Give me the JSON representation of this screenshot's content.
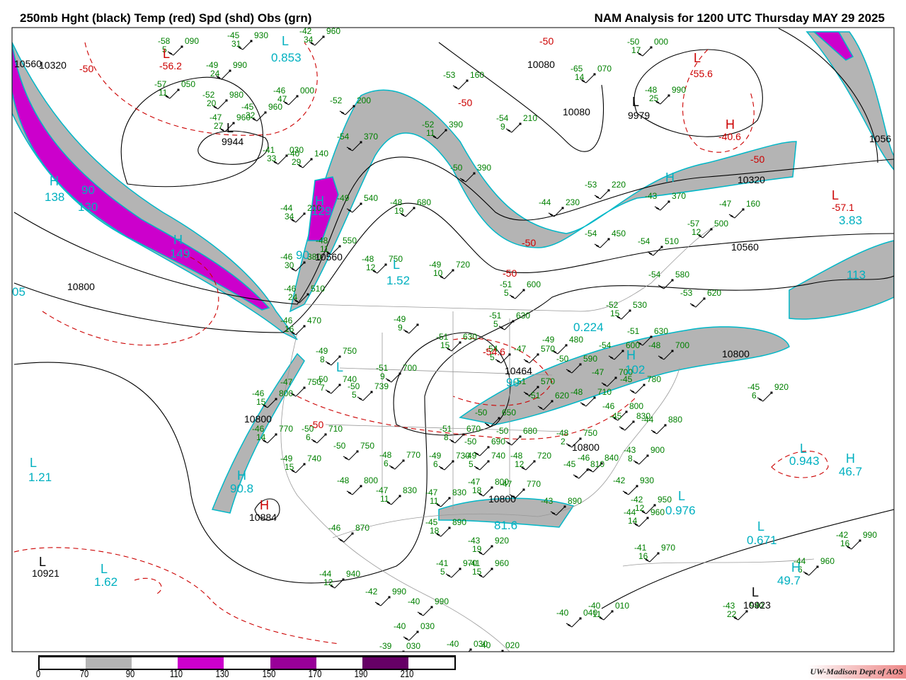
{
  "header": {
    "left_title": "250mb Hght (black) Temp (red) Spd (shd) Obs (grn)",
    "right_title": "NAM Analysis for 1200 UTC Thursday  MAY 29 2025"
  },
  "colors": {
    "height": "#000000",
    "temp": "#cc0000",
    "speed_label": "#00b0c0",
    "obs": "#008000",
    "shade_70_90": "#b4b4b4",
    "shade_110_130": "#cc00cc",
    "shade_150_170": "#990099",
    "shade_190_210": "#660066"
  },
  "legend": {
    "ticks": [
      "0",
      "70",
      "90",
      "110",
      "130",
      "150",
      "170",
      "190",
      "210"
    ],
    "segments": [
      "#ffffff",
      "#b4b4b4",
      "#ffffff",
      "#cc00cc",
      "#ffffff",
      "#990099",
      "#ffffff",
      "#660066",
      "#ffffff"
    ]
  },
  "credit": "UW-Madison   Dept of AOS",
  "height_labels": [
    "10560",
    "10320",
    "10080",
    "10080",
    "9979",
    "9944",
    "10320",
    "10560",
    "10560",
    "10800",
    "10800",
    "10464",
    "10800",
    "10800",
    "10800",
    "10884",
    "10921",
    "10923",
    "1056"
  ],
  "temp_labels": [
    "-56.2",
    "-50",
    "-50",
    "-55.6",
    "-40.6",
    "-50",
    "-57.1",
    "-50",
    "-50",
    "-50",
    "-54.6",
    "-50"
  ],
  "speed_labels": [
    "0.853",
    "138",
    "90",
    "130",
    "149",
    "129",
    "90",
    "05",
    "1.52",
    "0.224",
    "102",
    "3.83",
    "113",
    "1.21",
    "0.943",
    "46.7",
    "0.976",
    "0.671",
    "1.62",
    "49.7",
    "90.8",
    "81.6",
    "90"
  ],
  "centers": [
    {
      "type": "L",
      "color": "speed"
    },
    {
      "type": "H",
      "color": "speed"
    },
    {
      "type": "H",
      "color": "speed"
    },
    {
      "type": "H",
      "color": "speed"
    },
    {
      "type": "L",
      "color": "height"
    },
    {
      "type": "L",
      "color": "height"
    },
    {
      "type": "L",
      "color": "temp"
    },
    {
      "type": "L",
      "color": "temp"
    },
    {
      "type": "H",
      "color": "temp"
    },
    {
      "type": "L",
      "color": "temp"
    },
    {
      "type": "L",
      "color": "speed"
    },
    {
      "type": "H",
      "color": "speed"
    },
    {
      "type": "H",
      "color": "speed"
    },
    {
      "type": "L",
      "color": "speed"
    },
    {
      "type": "L",
      "color": "speed"
    },
    {
      "type": "H",
      "color": "speed"
    },
    {
      "type": "L",
      "color": "speed"
    },
    {
      "type": "L",
      "color": "speed"
    },
    {
      "type": "L",
      "color": "speed"
    },
    {
      "type": "H",
      "color": "speed"
    },
    {
      "type": "H",
      "color": "temp"
    },
    {
      "type": "L",
      "color": "height"
    },
    {
      "type": "L",
      "color": "height"
    },
    {
      "type": "H",
      "color": "speed"
    },
    {
      "type": "L",
      "color": "speed"
    }
  ],
  "stations": [
    [
      "-58",
      "090",
      "5"
    ],
    [
      "-45",
      "930",
      "31"
    ],
    [
      "-42",
      "960",
      "34"
    ],
    [
      "-49",
      "990",
      "24"
    ],
    [
      "-57",
      "050",
      "11"
    ],
    [
      "-52",
      "980",
      "20"
    ],
    [
      "-46",
      "000",
      "47"
    ],
    [
      "-45",
      "960",
      "32"
    ],
    [
      "-47",
      "960",
      "27"
    ],
    [
      "-52",
      "200",
      ""
    ],
    [
      "-53",
      "160",
      ""
    ],
    [
      "-65",
      "070",
      "14"
    ],
    [
      "-50",
      "000",
      "17"
    ],
    [
      "-48",
      "990",
      "25"
    ],
    [
      "-54",
      "210",
      "9"
    ],
    [
      "-52",
      "390",
      "11"
    ],
    [
      "-54",
      "370",
      ""
    ],
    [
      "-41",
      "030",
      "33"
    ],
    [
      "-40",
      "140",
      "29"
    ],
    [
      "-50",
      "390",
      ""
    ],
    [
      "-53",
      "220",
      ""
    ],
    [
      "-44",
      "230",
      ""
    ],
    [
      "-43",
      "370",
      ""
    ],
    [
      "-47",
      "160",
      ""
    ],
    [
      "-57",
      "500",
      "12"
    ],
    [
      "-49",
      "540",
      ""
    ],
    [
      "-48",
      "680",
      "19"
    ],
    [
      "-44",
      "210",
      "34"
    ],
    [
      "-48",
      "550",
      "11"
    ],
    [
      "-54",
      "450",
      ""
    ],
    [
      "-54",
      "510",
      ""
    ],
    [
      "-46",
      "380",
      "30"
    ],
    [
      "-48",
      "750",
      "12"
    ],
    [
      "-49",
      "720",
      "10"
    ],
    [
      "-51",
      "600",
      "5"
    ],
    [
      "-54",
      "580",
      ""
    ],
    [
      "-46",
      "510",
      "24"
    ],
    [
      "-53",
      "620",
      ""
    ],
    [
      "-52",
      "530",
      "15"
    ],
    [
      "-51",
      "630",
      "5"
    ],
    [
      "-49",
      "",
      "9"
    ],
    [
      "-46",
      "470",
      "16"
    ],
    [
      "-51",
      "630",
      "15"
    ],
    [
      "-51",
      "630",
      ""
    ],
    [
      "-49",
      "480",
      ""
    ],
    [
      "-54",
      "600",
      ""
    ],
    [
      "-48",
      "700",
      ""
    ],
    [
      "-49",
      "750",
      "8"
    ],
    [
      "-54",
      "",
      "5"
    ],
    [
      "-47",
      "570",
      ""
    ],
    [
      "-51",
      "700",
      "9"
    ],
    [
      "-50",
      "590",
      ""
    ],
    [
      "-50",
      "740",
      "7"
    ],
    [
      "-50",
      "739",
      "5"
    ],
    [
      "-47",
      "750",
      ""
    ],
    [
      "-47",
      "700",
      ""
    ],
    [
      "-45",
      "780",
      ""
    ],
    [
      "-46",
      "800",
      "15"
    ],
    [
      "-51",
      "570",
      ""
    ],
    [
      "-51",
      "620",
      ""
    ],
    [
      "-48",
      "710",
      ""
    ],
    [
      "-50",
      "650",
      ""
    ],
    [
      "-46",
      "800",
      ""
    ],
    [
      "-46",
      "770",
      "14"
    ],
    [
      "-50",
      "710",
      "6"
    ],
    [
      "-51",
      "670",
      "8"
    ],
    [
      "-50",
      "680",
      ""
    ],
    [
      "-48",
      "750",
      "2"
    ],
    [
      "-44",
      "880",
      ""
    ],
    [
      "-45",
      "830",
      ""
    ],
    [
      "-50",
      "750",
      ""
    ],
    [
      "-50",
      "690",
      ""
    ],
    [
      "-48",
      "770",
      "6"
    ],
    [
      "-49",
      "730",
      "6"
    ],
    [
      "-49",
      "740",
      "5"
    ],
    [
      "-48",
      "720",
      "12"
    ],
    [
      "-46",
      "840",
      ""
    ],
    [
      "-43",
      "900",
      "8"
    ],
    [
      "-49",
      "740",
      "15"
    ],
    [
      "-45",
      "810",
      ""
    ],
    [
      "-48",
      "800",
      ""
    ],
    [
      "-47",
      "830",
      "11"
    ],
    [
      "-47",
      "830",
      "11"
    ],
    [
      "-47",
      "800",
      "18"
    ],
    [
      "-47",
      "770",
      ""
    ],
    [
      "-42",
      "930",
      ""
    ],
    [
      "-43",
      "890",
      ""
    ],
    [
      "-42",
      "950",
      "12"
    ],
    [
      "-44",
      "960",
      "14"
    ],
    [
      "-46",
      "870",
      ""
    ],
    [
      "-45",
      "890",
      "18"
    ],
    [
      "-43",
      "920",
      "19"
    ],
    [
      "-41",
      "970",
      "16"
    ],
    [
      "-41",
      "970",
      "5"
    ],
    [
      "-41",
      "960",
      "15"
    ],
    [
      "-44",
      "940",
      "12"
    ],
    [
      "-42",
      "990",
      ""
    ],
    [
      "-40",
      "990",
      ""
    ],
    [
      "-40",
      "010",
      "11"
    ],
    [
      "-40",
      "040",
      ""
    ],
    [
      "-43",
      "940",
      "22"
    ],
    [
      "-40",
      "030",
      ""
    ],
    [
      "-39",
      "030",
      ""
    ],
    [
      "-40",
      "030",
      ""
    ],
    [
      "-40",
      "020",
      ""
    ],
    [
      "-45",
      "920",
      "6"
    ],
    [
      "-42",
      "990",
      "16"
    ],
    [
      "-44",
      "960",
      "6"
    ]
  ]
}
